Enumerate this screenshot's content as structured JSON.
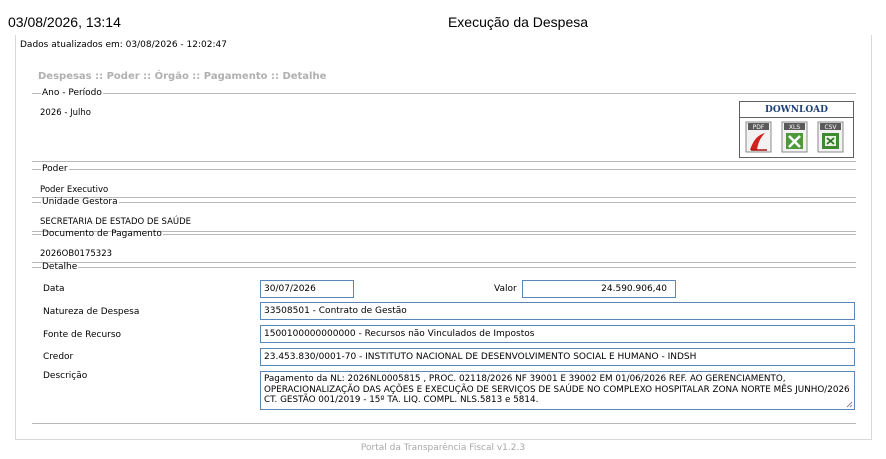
{
  "header": {
    "datetime": "03/08/2026, 13:14",
    "title": "Execução da Despesa"
  },
  "updated_text": "Dados atualizados em: 03/08/2026 - 12:02:47",
  "breadcrumb": "Despesas :: Poder :: Órgão :: Pagamento :: Detalhe",
  "ano_periodo": {
    "legend": "Ano - Período",
    "value": "2026 - Julho"
  },
  "download": {
    "title": "DOWNLOAD",
    "items": [
      {
        "label": "PDF",
        "icon": "pdf-icon"
      },
      {
        "label": "XLS",
        "icon": "xls-icon"
      },
      {
        "label": "CSV",
        "icon": "csv-icon"
      }
    ]
  },
  "poder": {
    "legend": "Poder",
    "value": "Poder Executivo"
  },
  "unidade_gestora": {
    "legend": "Unidade Gestora",
    "value": "SECRETARIA DE ESTADO DE SAÚDE"
  },
  "documento_pagamento": {
    "legend": "Documento de Pagamento",
    "value": "2026OB0175323"
  },
  "detalhe": {
    "legend": "Detalhe",
    "data_label": "Data",
    "data_value": "30/07/2026",
    "valor_label": "Valor",
    "valor_value": "24.590.906,40",
    "natureza_label": "Natureza de Despesa",
    "natureza_value": "33508501 - Contrato de Gestão",
    "fonte_label": "Fonte de Recurso",
    "fonte_value": "1500100000000000 - Recursos não Vinculados de Impostos",
    "credor_label": "Credor",
    "credor_value": "23.453.830/0001-70 - INSTITUTO NACIONAL DE DESENVOLVIMENTO SOCIAL E HUMANO - INDSH",
    "descricao_label": "Descrição",
    "descricao_value": "Pagamento da NL: 2026NL0005815 , PROC. 02118/2026 NF 39001 E 39002 EM 01/06/2026 REF. AO GERENCIAMENTO, OPERACIONALIZAÇÃO DAS AÇÕES E EXECUÇÃO DE SERVIÇOS DE SAÚDE NO COMPLEXO HOSPITALAR ZONA NORTE MÊS JUNHO/2026 CT. GESTÃO 001/2019 - 15º TA. LIQ. COMPL. NLS.5813 e 5814."
  },
  "footer": "Portal da Transparência Fiscal v1.2.3"
}
